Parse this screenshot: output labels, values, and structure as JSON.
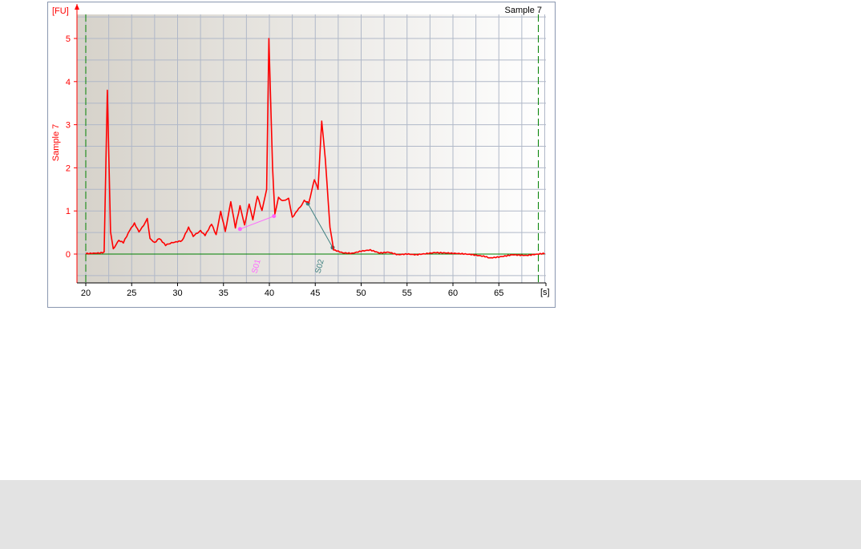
{
  "panel": {
    "sample_title": "Sample 7",
    "y_unit_label": "[FU]",
    "y_axis_title": "Sample 7",
    "x_unit_label": "[s]"
  },
  "colors": {
    "trace": "#ff0000",
    "marker_s01": "#ff66ff",
    "marker_s02": "#3d7f7f",
    "limit_line": "#008000",
    "grid": "#b0b8c8",
    "plot_bg_left": "#dcd8d0",
    "plot_bg_right": "#ffffff"
  },
  "chart_data": {
    "type": "line",
    "title": "Sample 7",
    "xlabel": "[s]",
    "ylabel": "Sample 7",
    "xlim": [
      20,
      70
    ],
    "ylim": [
      -0.6,
      5.5
    ],
    "x_ticks": [
      20,
      25,
      30,
      35,
      40,
      45,
      50,
      55,
      60,
      65
    ],
    "y_ticks": [
      0,
      1,
      2,
      3,
      4,
      5
    ],
    "grid": true,
    "series": [
      {
        "name": "Sample 7",
        "points": [
          [
            20.0,
            0.0
          ],
          [
            21.5,
            0.03
          ],
          [
            22.0,
            0.05
          ],
          [
            22.35,
            3.8
          ],
          [
            22.7,
            0.5
          ],
          [
            23.0,
            0.15
          ],
          [
            23.6,
            0.3
          ],
          [
            24.1,
            0.25
          ],
          [
            24.8,
            0.55
          ],
          [
            25.3,
            0.7
          ],
          [
            25.8,
            0.5
          ],
          [
            26.3,
            0.65
          ],
          [
            26.7,
            0.85
          ],
          [
            27.0,
            0.35
          ],
          [
            27.5,
            0.25
          ],
          [
            28.0,
            0.35
          ],
          [
            28.7,
            0.2
          ],
          [
            29.5,
            0.25
          ],
          [
            30.5,
            0.3
          ],
          [
            31.2,
            0.6
          ],
          [
            31.7,
            0.4
          ],
          [
            32.5,
            0.55
          ],
          [
            33.0,
            0.45
          ],
          [
            33.7,
            0.7
          ],
          [
            34.2,
            0.45
          ],
          [
            34.7,
            1.0
          ],
          [
            35.2,
            0.55
          ],
          [
            35.8,
            1.2
          ],
          [
            36.3,
            0.6
          ],
          [
            36.8,
            1.1
          ],
          [
            37.3,
            0.65
          ],
          [
            37.8,
            1.15
          ],
          [
            38.2,
            0.8
          ],
          [
            38.7,
            1.35
          ],
          [
            39.2,
            1.0
          ],
          [
            39.7,
            1.5
          ],
          [
            39.95,
            5.0
          ],
          [
            40.35,
            2.0
          ],
          [
            40.6,
            0.95
          ],
          [
            41.0,
            1.3
          ],
          [
            41.6,
            1.25
          ],
          [
            42.1,
            1.3
          ],
          [
            42.5,
            0.85
          ],
          [
            43.2,
            1.05
          ],
          [
            43.8,
            1.25
          ],
          [
            44.3,
            1.2
          ],
          [
            44.9,
            1.7
          ],
          [
            45.3,
            1.5
          ],
          [
            45.7,
            3.1
          ],
          [
            46.1,
            2.2
          ],
          [
            46.6,
            0.6
          ],
          [
            47.0,
            0.1
          ],
          [
            48.0,
            0.02
          ],
          [
            49.0,
            0.0
          ],
          [
            50.0,
            0.05
          ],
          [
            51.0,
            0.08
          ],
          [
            52.0,
            0.02
          ],
          [
            53.0,
            0.05
          ],
          [
            54.0,
            0.0
          ],
          [
            55.0,
            0.02
          ],
          [
            56.0,
            0.0
          ],
          [
            58.0,
            0.03
          ],
          [
            60.0,
            0.0
          ],
          [
            62.0,
            -0.02
          ],
          [
            63.5,
            -0.05
          ],
          [
            64.0,
            -0.08
          ],
          [
            65.0,
            -0.05
          ],
          [
            66.5,
            0.0
          ],
          [
            68.0,
            -0.03
          ],
          [
            70.0,
            0.0
          ]
        ]
      }
    ],
    "markers": [
      {
        "name": "S01",
        "points": [
          [
            36.8,
            0.58
          ],
          [
            40.5,
            0.88
          ]
        ]
      },
      {
        "name": "S02",
        "points": [
          [
            44.2,
            1.17
          ],
          [
            46.9,
            0.15
          ]
        ]
      }
    ],
    "limit_lines_x": [
      20.0,
      69.3
    ],
    "baseline_y": 0
  }
}
